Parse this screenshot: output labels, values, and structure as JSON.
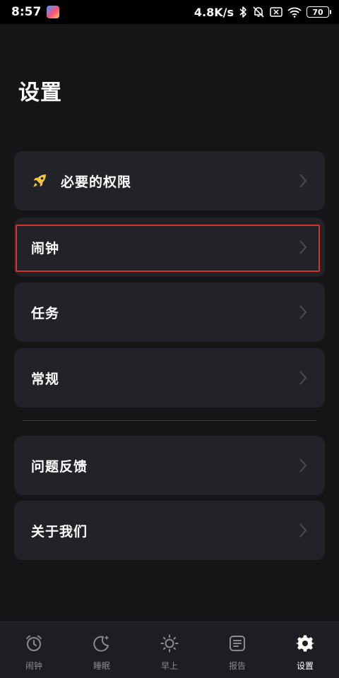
{
  "status_bar": {
    "time": "8:57",
    "network_speed": "4.8K/s",
    "battery": "70",
    "icons": [
      "app-badge-icon",
      "bluetooth-icon",
      "mute-bell-icon",
      "no-sim-icon",
      "wifi-icon",
      "battery-icon"
    ]
  },
  "page": {
    "title": "设置"
  },
  "menu": {
    "items": [
      {
        "label": "必要的权限",
        "icon": "rocket-icon"
      },
      {
        "label": "闹钟"
      },
      {
        "label": "任务"
      },
      {
        "label": "常规"
      },
      {
        "label": "问题反馈"
      },
      {
        "label": "关于我们"
      }
    ]
  },
  "tabbar": {
    "tabs": [
      {
        "label": "闹钟",
        "icon": "alarm-clock-icon"
      },
      {
        "label": "睡眠",
        "icon": "moon-icon"
      },
      {
        "label": "早上",
        "icon": "sun-icon"
      },
      {
        "label": "报告",
        "icon": "report-icon"
      },
      {
        "label": "设置",
        "icon": "gear-icon",
        "active": true
      }
    ]
  },
  "colors": {
    "background": "#151518",
    "card": "#222329",
    "highlight_border": "#d6332c",
    "tab_inactive": "#8a8b92",
    "rocket": "#f5c542"
  }
}
